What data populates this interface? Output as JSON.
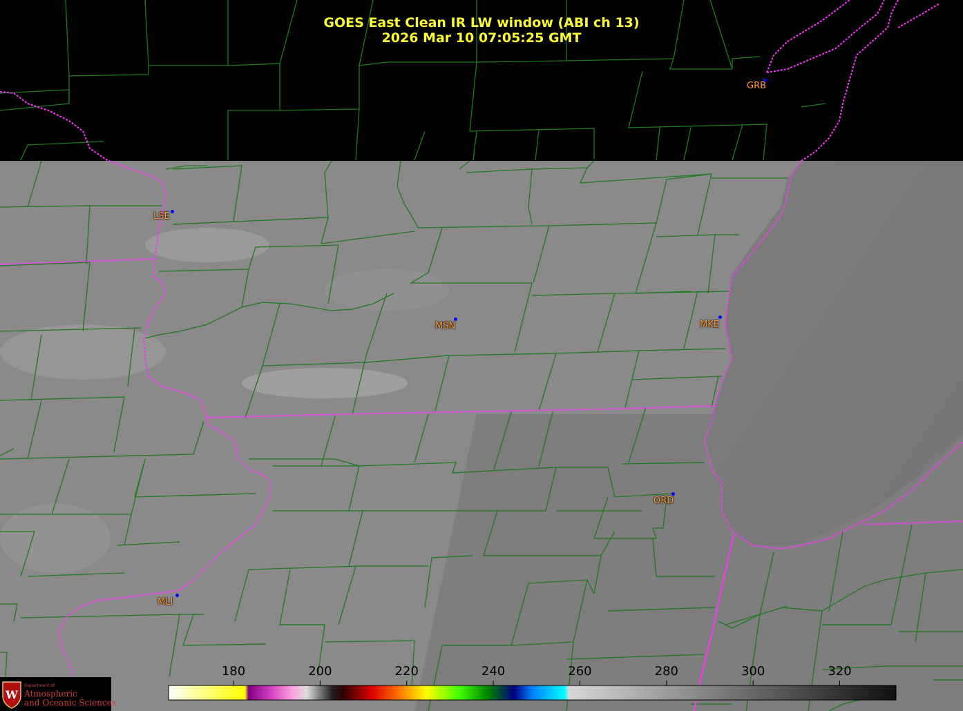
{
  "title": {
    "line1": "GOES East Clean IR LW window (ABI ch 13)",
    "line2": "2026 Mar 10  07:05:25 GMT"
  },
  "stations": [
    {
      "id": "GRB",
      "lat": 44.48,
      "lon": -88.13
    },
    {
      "id": "LSE",
      "lat": 43.88,
      "lon": -91.25
    },
    {
      "id": "MSN",
      "lat": 43.14,
      "lon": -89.35
    },
    {
      "id": "MKE",
      "lat": 42.95,
      "lon": -87.9
    },
    {
      "id": "ORD",
      "lat": 41.98,
      "lon": -87.9
    },
    {
      "id": "MLI",
      "lat": 41.45,
      "lon": -90.51
    }
  ],
  "colorbar": {
    "unit_range": [
      165,
      333
    ],
    "ticks": [
      "180",
      "200",
      "220",
      "240",
      "260",
      "280",
      "300",
      "320"
    ],
    "tick_values": [
      180,
      200,
      220,
      240,
      260,
      280,
      300,
      320
    ]
  },
  "logo": {
    "department": "Department of",
    "line1": "Atmospheric",
    "line2": "and Oceanic Sciences",
    "icon": "uw-crest-icon"
  },
  "colors": {
    "title": "#ffff33",
    "station_label": "#ff9a33",
    "station_dot": "#0000ff",
    "county_lines": "#1f7a1f",
    "state_lines": "#ff33ff",
    "background": "#000000"
  }
}
